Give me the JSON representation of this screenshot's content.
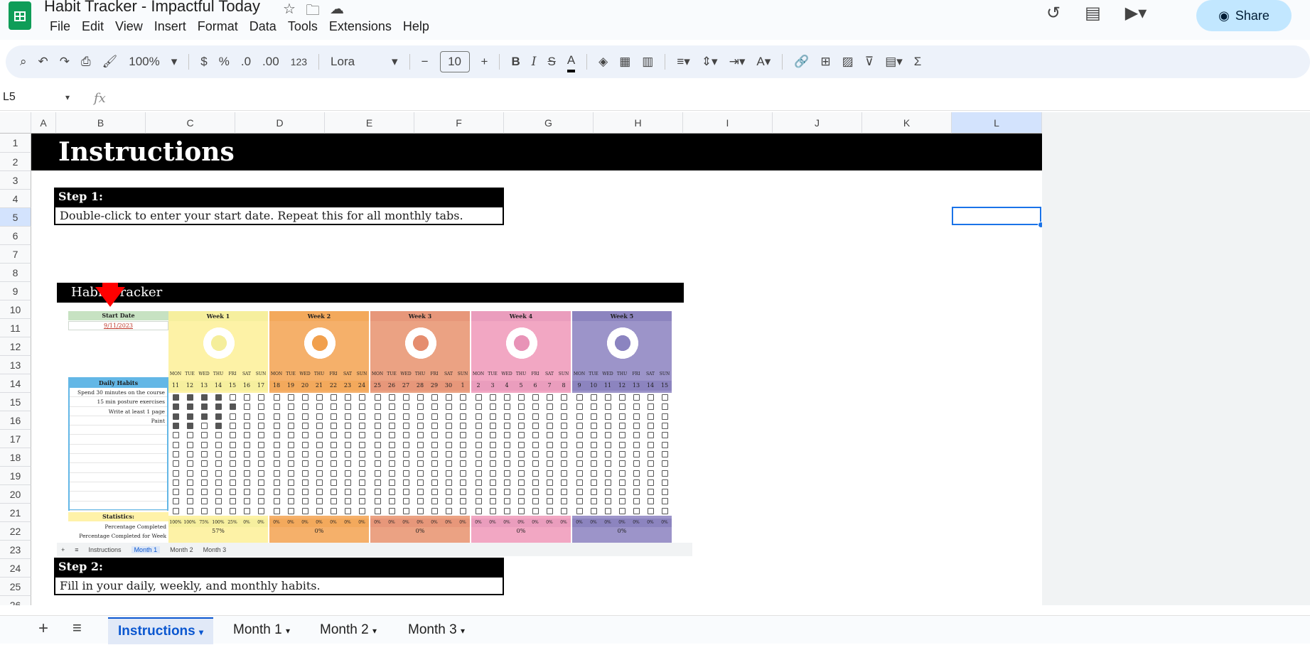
{
  "app": {
    "doc_title": "Habit Tracker - Impactful Today",
    "menu": [
      "File",
      "Edit",
      "View",
      "Insert",
      "Format",
      "Data",
      "Tools",
      "Extensions",
      "Help"
    ],
    "share_label": "Share"
  },
  "toolbar": {
    "zoom": "100%",
    "currency": "$",
    "percent": "%",
    "dec_decrease": ".0",
    "dec_increase": ".00",
    "number_format": "123",
    "font": "Lora",
    "font_size": "10",
    "bold": "B",
    "italic": "I",
    "strike": "S",
    "text_color": "A",
    "sum": "Σ"
  },
  "formula_bar": {
    "name_box": "L5",
    "fx": "fx"
  },
  "columns": [
    "A",
    "B",
    "C",
    "D",
    "E",
    "F",
    "G",
    "H",
    "I",
    "J",
    "K",
    "L"
  ],
  "rows": [
    "1",
    "2",
    "3",
    "4",
    "5",
    "6",
    "7",
    "8",
    "9",
    "10",
    "11",
    "12",
    "13",
    "14",
    "15",
    "16",
    "17",
    "18",
    "19",
    "20",
    "21",
    "22",
    "23",
    "24",
    "25",
    "26"
  ],
  "sheet": {
    "banner": "Instructions",
    "step1_title": "Step 1:",
    "step1_text": "Double-click to enter your start date. Repeat this for all monthly tabs.",
    "step2_title": "Step 2:",
    "step2_text": "Fill in your daily, weekly, and monthly habits."
  },
  "embedded": {
    "title": "Habit Tracker",
    "start_label": "Start Date",
    "start_value": "9/11/2023",
    "habits_title": "Daily Habits",
    "habits": [
      "Spend 30 minutes on the course",
      "15 min posture exercises",
      "Write at least 1 page",
      "Paint",
      "",
      "",
      "",
      "",
      "",
      "",
      "",
      "",
      ""
    ],
    "stats_title": "Statistics:",
    "stat_pct": "Percentage Completed",
    "stat_week": "Percentage Completed for Week",
    "day_names": [
      "MON",
      "TUE",
      "WED",
      "THU",
      "FRI",
      "SAT",
      "SUN"
    ],
    "weeks": [
      {
        "title": "Week 1",
        "dates": [
          "11",
          "12",
          "13",
          "14",
          "15",
          "16",
          "17"
        ],
        "pct": [
          "100%",
          "100%",
          "75%",
          "100%",
          "25%",
          "0%",
          "0%"
        ],
        "week_pct": "57%",
        "bg": "#fdf2a6",
        "hdr": "#f6ef9e",
        "donut": "#f5ee9b"
      },
      {
        "title": "Week 2",
        "dates": [
          "18",
          "19",
          "20",
          "21",
          "22",
          "23",
          "24"
        ],
        "pct": [
          "0%",
          "0%",
          "0%",
          "0%",
          "0%",
          "0%",
          "0%"
        ],
        "week_pct": "0%",
        "bg": "#f5b06a",
        "hdr": "#f3a95c",
        "donut": "#f1a04d"
      },
      {
        "title": "Week 3",
        "dates": [
          "25",
          "26",
          "27",
          "28",
          "29",
          "30",
          "1"
        ],
        "pct": [
          "0%",
          "0%",
          "0%",
          "0%",
          "0%",
          "0%",
          "0%"
        ],
        "week_pct": "0%",
        "bg": "#eba283",
        "hdr": "#e7977a",
        "donut": "#e58d6f"
      },
      {
        "title": "Week 4",
        "dates": [
          "2",
          "3",
          "4",
          "5",
          "6",
          "7",
          "8"
        ],
        "pct": [
          "0%",
          "0%",
          "0%",
          "0%",
          "0%",
          "0%",
          "0%"
        ],
        "week_pct": "0%",
        "bg": "#f2a7c3",
        "hdr": "#ea9dbd",
        "donut": "#e893b7"
      },
      {
        "title": "Week 5",
        "dates": [
          "9",
          "10",
          "11",
          "12",
          "13",
          "14",
          "15"
        ],
        "pct": [
          "0%",
          "0%",
          "0%",
          "0%",
          "0%",
          "0%",
          "0%"
        ],
        "week_pct": "0%",
        "bg": "#9c94c9",
        "hdr": "#8c84bf",
        "donut": "#8b84c0"
      }
    ],
    "tabs": [
      "Instructions",
      "Month 1",
      "Month 2",
      "Month 3"
    ],
    "active_tab": "Month 1"
  },
  "sheet_tabs": [
    "Instructions",
    "Month 1",
    "Month 2",
    "Month 3"
  ],
  "active_sheet": "Instructions"
}
